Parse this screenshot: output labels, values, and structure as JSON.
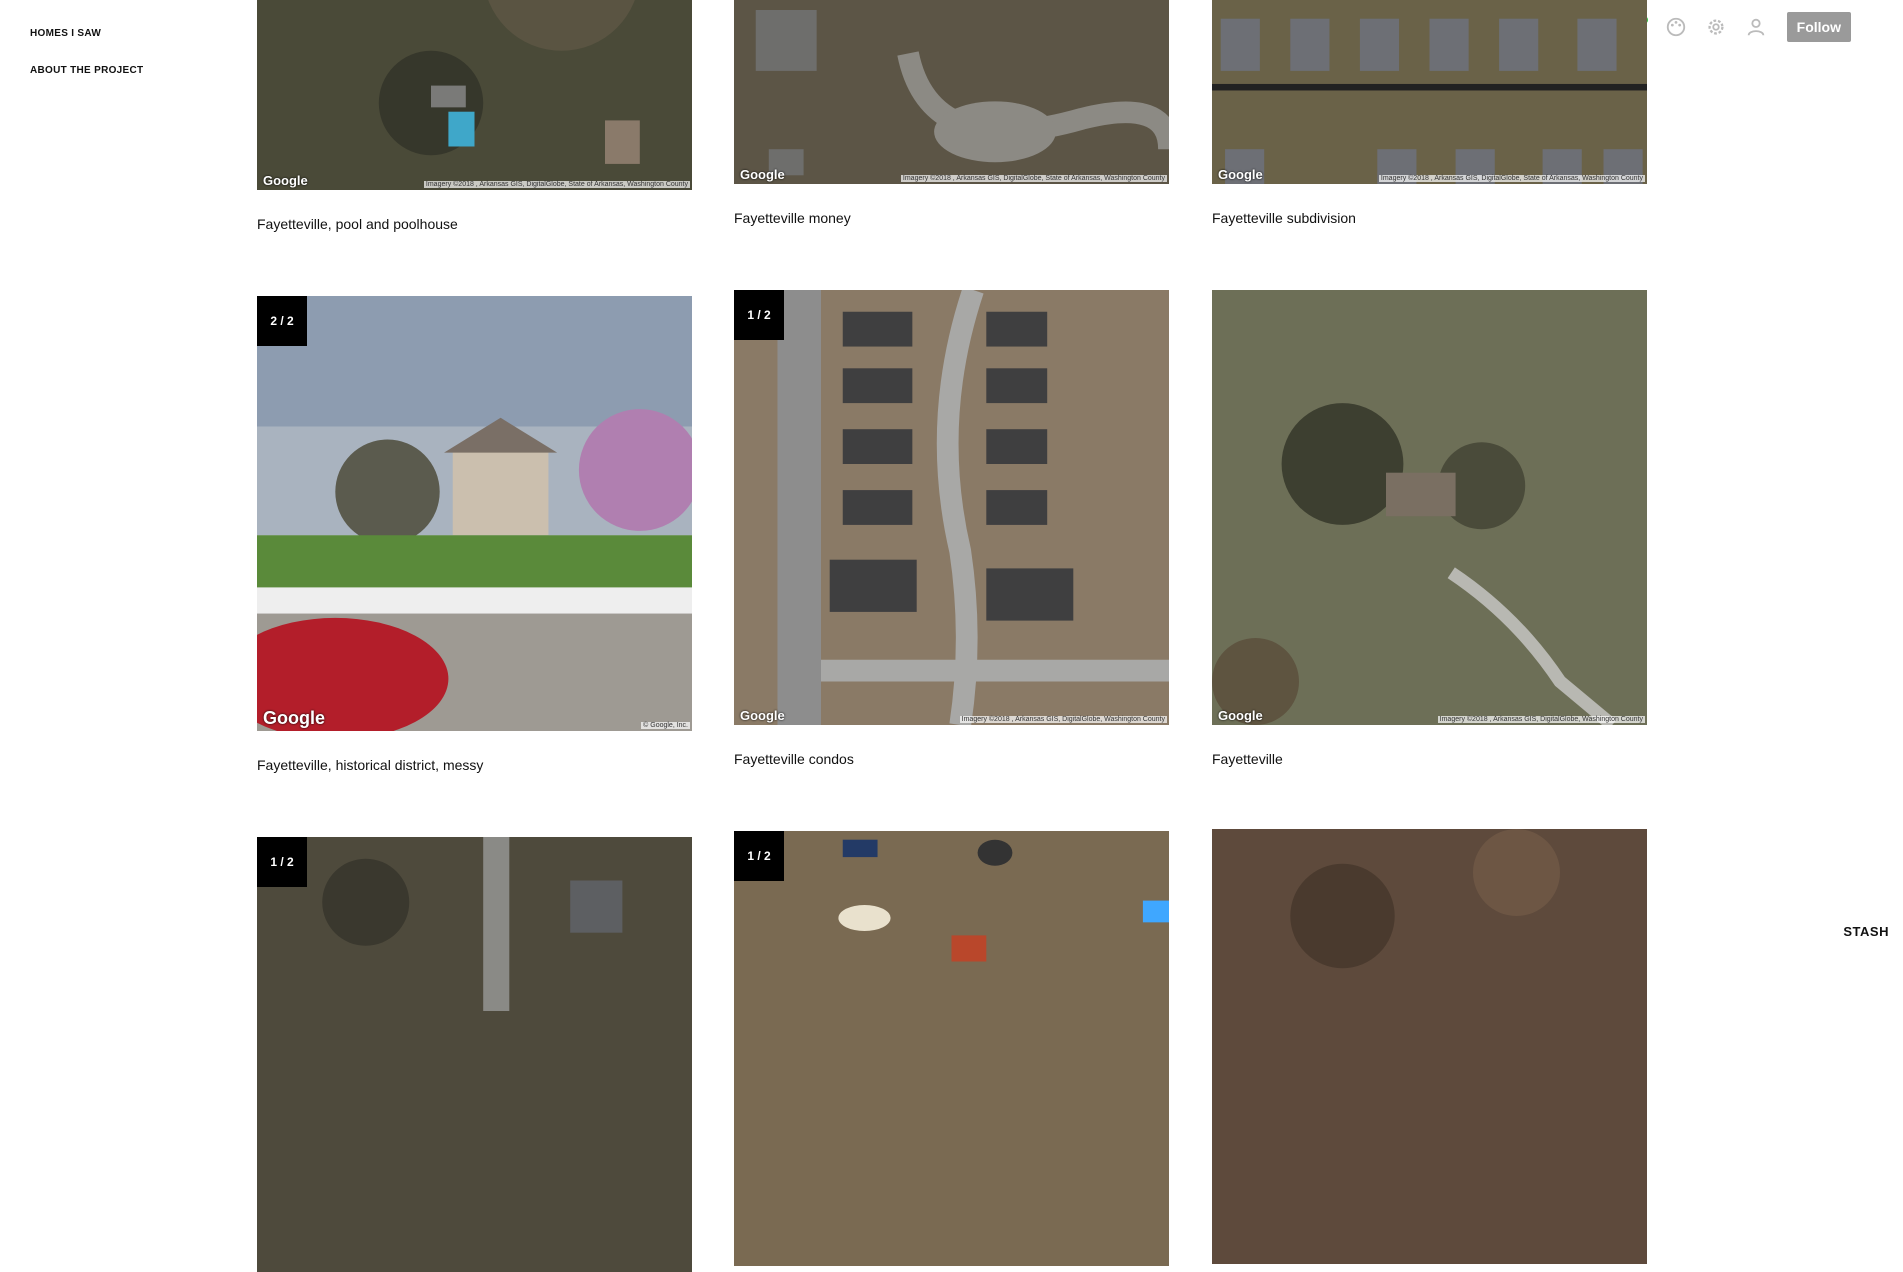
{
  "nav": {
    "items": [
      {
        "label": "HOMES I SAW"
      },
      {
        "label": "ABOUT THE PROJECT"
      }
    ]
  },
  "toolbar": {
    "icons": [
      "home-icon",
      "new-post-icon",
      "palette-icon",
      "settings-icon",
      "account-icon"
    ],
    "follow_label": "Follow",
    "accent": "#25c43b"
  },
  "posts": [
    {
      "caption": "Fayetteville, pool and poolhouse",
      "counter": "",
      "mark": "Google",
      "credit": "Imagery ©2018 , Arkansas GIS, DigitalGlobe, State of Arkansas, Washington County"
    },
    {
      "caption": "Fayetteville money",
      "counter": "",
      "mark": "Google",
      "credit": "Imagery ©2018 , Arkansas GIS, DigitalGlobe, State of Arkansas, Washington County"
    },
    {
      "caption": "Fayetteville subdivision",
      "counter": "",
      "mark": "Google",
      "credit": "Imagery ©2018 , Arkansas GIS, DigitalGlobe, State of Arkansas, Washington County"
    },
    {
      "caption": "Fayetteville, historical district, messy",
      "counter": "2 / 2",
      "mark": "Google",
      "credit": "© Google, Inc."
    },
    {
      "caption": "Fayetteville condos",
      "counter": "1 / 2",
      "mark": "Google",
      "credit": "Imagery ©2018 , Arkansas GIS, DigitalGlobe, Washington County"
    },
    {
      "caption": "Fayetteville",
      "counter": "",
      "mark": "Google",
      "credit": "Imagery ©2018 , Arkansas GIS, DigitalGlobe, Washington County"
    },
    {
      "caption": "",
      "counter": "1 / 2",
      "mark": "",
      "credit": ""
    },
    {
      "caption": "",
      "counter": "1 / 2",
      "mark": "",
      "credit": ""
    },
    {
      "caption": "",
      "counter": "",
      "mark": "",
      "credit": ""
    }
  ],
  "footer": {
    "brand": "STASH"
  }
}
